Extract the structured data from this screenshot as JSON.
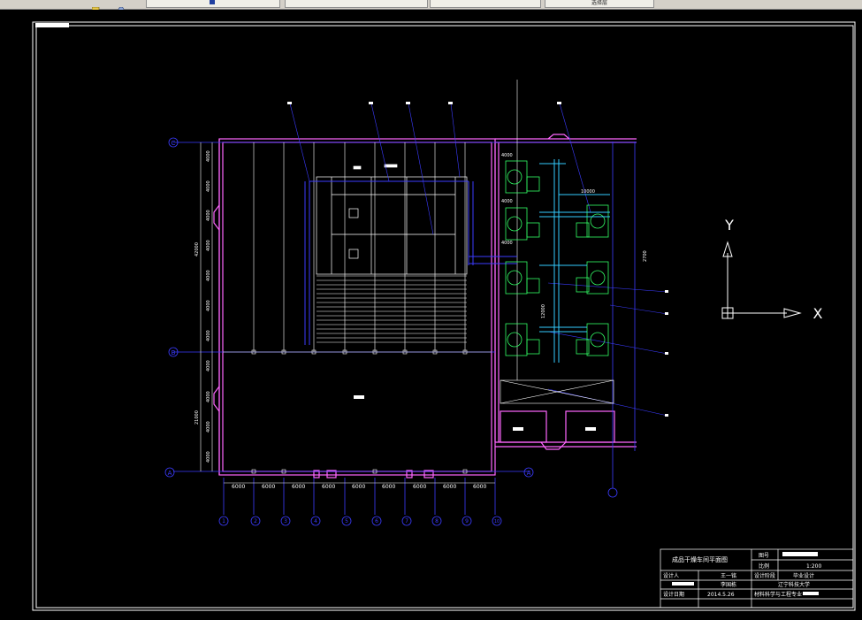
{
  "toolbar": {
    "tabs": [
      {
        "label": ""
      },
      {
        "label": ""
      },
      {
        "label": ""
      },
      {
        "label": ""
      }
    ],
    "layer_combo": "选择层"
  },
  "ucs": {
    "x_label": "X",
    "y_label": "Y"
  },
  "drawing": {
    "row_axes": [
      "C",
      "B",
      "A"
    ],
    "col_axes": [
      "1",
      "2",
      "3",
      "4",
      "5",
      "6",
      "7",
      "8",
      "9",
      "10"
    ],
    "bay_spacing": [
      "6000",
      "6000",
      "6000",
      "6000",
      "6000",
      "6000",
      "6000",
      "6000",
      "6000"
    ],
    "left_dims": [
      "4000",
      "4000",
      "4000",
      "4000",
      "4000",
      "4000",
      "4000",
      "4000",
      "4000",
      "4000",
      "4000",
      "4000"
    ],
    "left_total_top": "42000",
    "left_total_bottom": "21000",
    "right_dims": [
      "4000",
      "4000",
      "4000"
    ],
    "right_vertical_dim": "12000",
    "right_small_dim": "2700",
    "right_axis": "A",
    "dryer_dim": "10000"
  },
  "title_block": {
    "title": "成品干燥车间平面图",
    "drawing_no_label": "图号",
    "scale_label": "比例",
    "scale_value": "1:200",
    "designer_label": "设计人",
    "designer_name": "王一铭",
    "stage_label": "设计阶段",
    "stage_value": "毕业设计",
    "reviewer_name": "李国栋",
    "school": "辽宁科技大学",
    "date_label": "设计日期",
    "date_value": "2014.5.26",
    "major": "材料科学与工程专业"
  },
  "colors": {
    "wall": "#ff66ff",
    "grid": "#3b3bff",
    "line": "#ffffff",
    "equipment": "#33ff66",
    "equipment_accent": "#33ccff",
    "toolbar_bg": "#d4d0c8"
  }
}
